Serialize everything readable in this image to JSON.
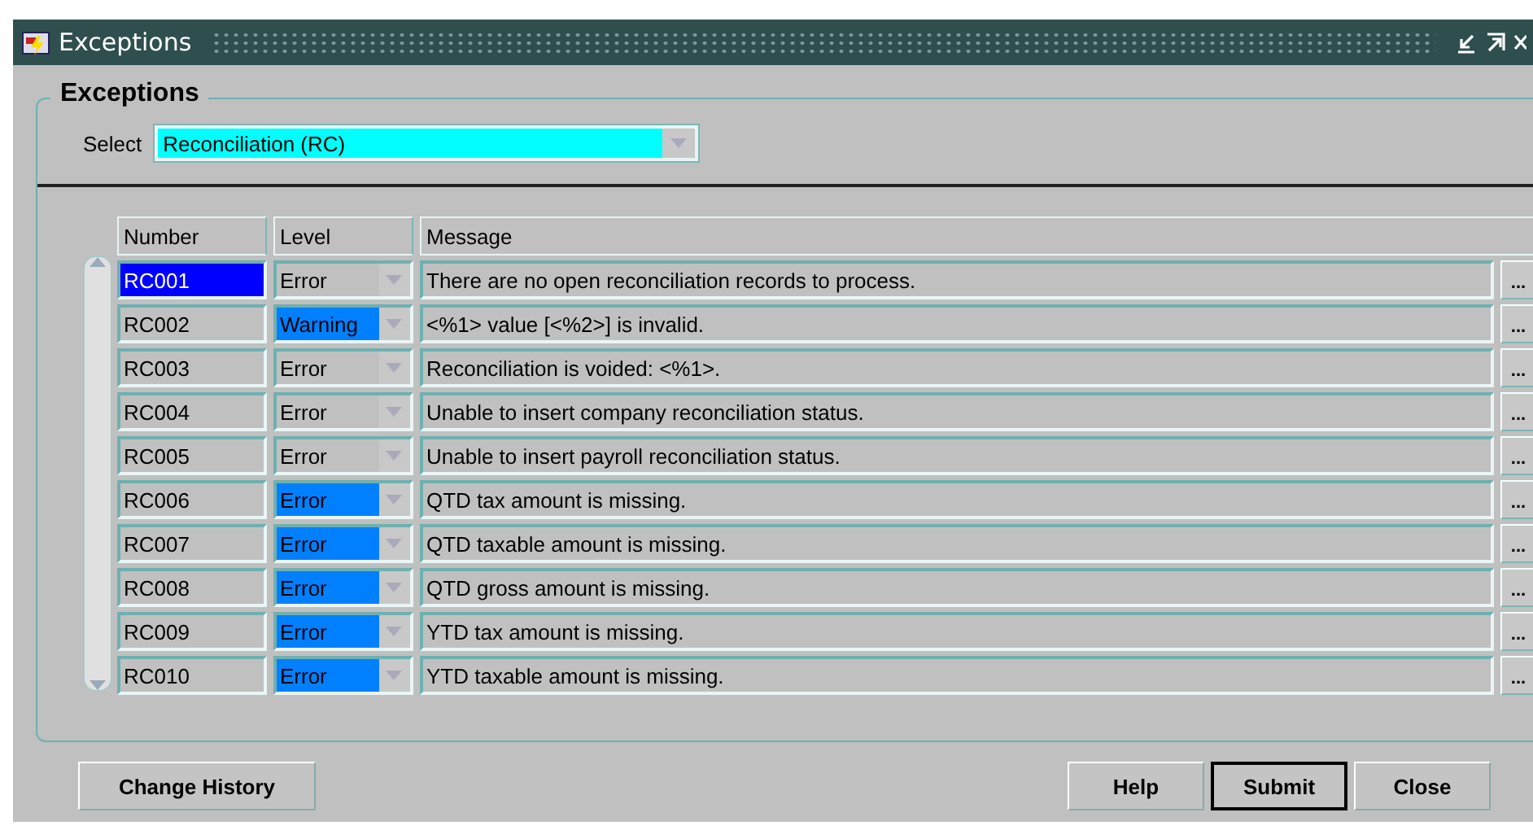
{
  "window": {
    "title": "Exceptions"
  },
  "section": {
    "title": "Exceptions"
  },
  "select": {
    "label": "Select",
    "value": "Reconciliation (RC)"
  },
  "table": {
    "columns": [
      "Number",
      "Level",
      "Message"
    ],
    "rows": [
      {
        "number": "RC001",
        "level": "Error",
        "message": "There are no open reconciliation records to process.",
        "selected": true,
        "highlighted": false,
        "more": "..."
      },
      {
        "number": "RC002",
        "level": "Warning",
        "message": "<%1> value [<%2>] is invalid.",
        "selected": false,
        "highlighted": true,
        "more": "..."
      },
      {
        "number": "RC003",
        "level": "Error",
        "message": "Reconciliation is voided: <%1>.",
        "selected": false,
        "highlighted": false,
        "more": "..."
      },
      {
        "number": "RC004",
        "level": "Error",
        "message": "Unable to insert company reconciliation status.",
        "selected": false,
        "highlighted": false,
        "more": "..."
      },
      {
        "number": "RC005",
        "level": "Error",
        "message": "Unable to insert payroll reconciliation status.",
        "selected": false,
        "highlighted": false,
        "more": "..."
      },
      {
        "number": "RC006",
        "level": "Error",
        "message": "QTD tax amount is missing.",
        "selected": false,
        "highlighted": true,
        "more": "..."
      },
      {
        "number": "RC007",
        "level": "Error",
        "message": "QTD taxable amount is missing.",
        "selected": false,
        "highlighted": true,
        "more": "..."
      },
      {
        "number": "RC008",
        "level": "Error",
        "message": "QTD gross amount is missing.",
        "selected": false,
        "highlighted": true,
        "more": "..."
      },
      {
        "number": "RC009",
        "level": "Error",
        "message": "YTD tax amount is missing.",
        "selected": false,
        "highlighted": true,
        "more": "..."
      },
      {
        "number": "RC010",
        "level": "Error",
        "message": "YTD taxable amount is missing.",
        "selected": false,
        "highlighted": true,
        "more": "..."
      }
    ]
  },
  "buttons": [
    {
      "label": "Change History",
      "kind": "left",
      "default": false
    },
    {
      "label": "Help",
      "kind": "right",
      "default": false
    },
    {
      "label": "Submit",
      "kind": "right",
      "default": true
    },
    {
      "label": "Close",
      "kind": "right",
      "default": false
    }
  ]
}
